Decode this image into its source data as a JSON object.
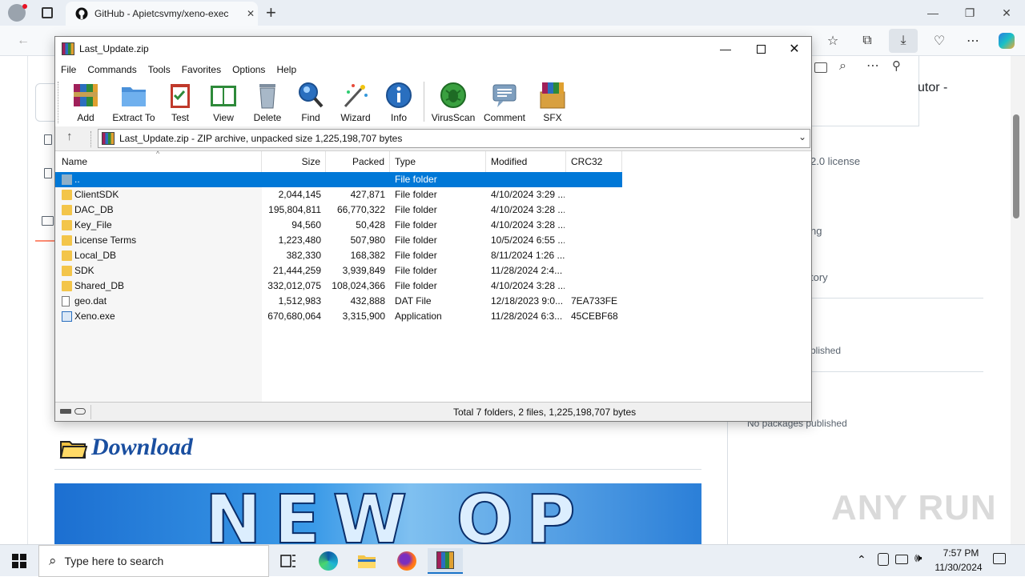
{
  "browser": {
    "tab_title": "GitHub - Apietcsvmy/xeno-exec",
    "new_tab_symbol": "+",
    "close_tab_symbol": "✕"
  },
  "page": {
    "sidebar_right_texts": [
      "utor -",
      "2.0 license",
      "ng",
      "tory",
      "blished",
      "No packages published"
    ],
    "download_heading": "Download",
    "banner_text": "NEW OP",
    "watermark": "ANY RUN"
  },
  "winrar": {
    "title": "Last_Update.zip",
    "menu": [
      "File",
      "Commands",
      "Tools",
      "Favorites",
      "Options",
      "Help"
    ],
    "tools": [
      {
        "label": "Add",
        "icon": "add-icon"
      },
      {
        "label": "Extract To",
        "icon": "extract-to-icon"
      },
      {
        "label": "Test",
        "icon": "test-icon"
      },
      {
        "label": "View",
        "icon": "view-icon"
      },
      {
        "label": "Delete",
        "icon": "delete-icon"
      },
      {
        "label": "Find",
        "icon": "find-icon"
      },
      {
        "label": "Wizard",
        "icon": "wizard-icon"
      },
      {
        "label": "Info",
        "icon": "info-icon"
      },
      {
        "label": "VirusScan",
        "icon": "virusscan-icon"
      },
      {
        "label": "Comment",
        "icon": "comment-icon"
      },
      {
        "label": "SFX",
        "icon": "sfx-icon"
      }
    ],
    "address": "Last_Update.zip - ZIP archive, unpacked size 1,225,198,707 bytes",
    "columns": [
      "Name",
      "Size",
      "Packed",
      "Type",
      "Modified",
      "CRC32"
    ],
    "rows": [
      {
        "name": "..",
        "size": "",
        "packed": "",
        "type": "File folder",
        "modified": "",
        "crc": "",
        "kind": "up"
      },
      {
        "name": "ClientSDK",
        "size": "2,044,145",
        "packed": "427,871",
        "type": "File folder",
        "modified": "4/10/2024 3:29 ...",
        "crc": "",
        "kind": "folder"
      },
      {
        "name": "DAC_DB",
        "size": "195,804,811",
        "packed": "66,770,322",
        "type": "File folder",
        "modified": "4/10/2024 3:28 ...",
        "crc": "",
        "kind": "folder"
      },
      {
        "name": "Key_File",
        "size": "94,560",
        "packed": "50,428",
        "type": "File folder",
        "modified": "4/10/2024 3:28 ...",
        "crc": "",
        "kind": "folder"
      },
      {
        "name": "License Terms",
        "size": "1,223,480",
        "packed": "507,980",
        "type": "File folder",
        "modified": "10/5/2024 6:55 ...",
        "crc": "",
        "kind": "folder"
      },
      {
        "name": "Local_DB",
        "size": "382,330",
        "packed": "168,382",
        "type": "File folder",
        "modified": "8/11/2024 1:26 ...",
        "crc": "",
        "kind": "folder"
      },
      {
        "name": "SDK",
        "size": "21,444,259",
        "packed": "3,939,849",
        "type": "File folder",
        "modified": "11/28/2024 2:4...",
        "crc": "",
        "kind": "folder"
      },
      {
        "name": "Shared_DB",
        "size": "332,012,075",
        "packed": "108,024,366",
        "type": "File folder",
        "modified": "4/10/2024 3:28 ...",
        "crc": "",
        "kind": "folder"
      },
      {
        "name": "geo.dat",
        "size": "1,512,983",
        "packed": "432,888",
        "type": "DAT File",
        "modified": "12/18/2023 9:0...",
        "crc": "7EA733FE",
        "kind": "file"
      },
      {
        "name": "Xeno.exe",
        "size": "670,680,064",
        "packed": "3,315,900",
        "type": "Application",
        "modified": "11/28/2024 6:3...",
        "crc": "45CEBF68",
        "kind": "exe"
      }
    ],
    "status": "Total 7 folders, 2 files, 1,225,198,707 bytes"
  },
  "taskbar": {
    "search_placeholder": "Type here to search",
    "time": "7:57 PM",
    "date": "11/30/2024"
  },
  "colors": {
    "selection": "#0078d7",
    "folder": "#f3c54a",
    "download_heading": "#1a4fa0"
  }
}
